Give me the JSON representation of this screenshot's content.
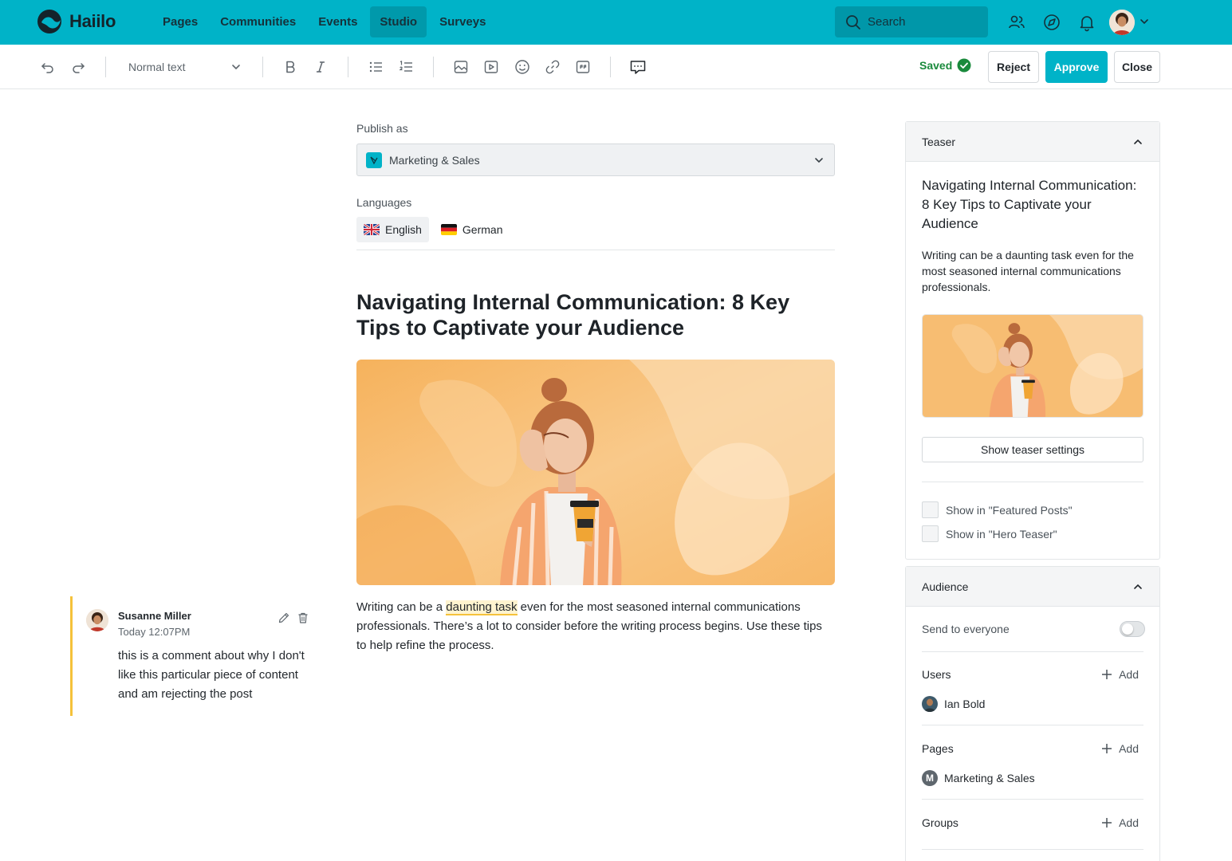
{
  "app": {
    "name": "Haiilo"
  },
  "nav": {
    "items": [
      {
        "label": "Pages"
      },
      {
        "label": "Communities"
      },
      {
        "label": "Events"
      },
      {
        "label": "Studio",
        "active": true
      },
      {
        "label": "Surveys"
      }
    ],
    "search_placeholder": "Search",
    "icons": [
      "colleagues-icon",
      "compass-icon",
      "bell-icon",
      "user-avatar",
      "chevron-down-icon"
    ]
  },
  "toolbar": {
    "text_style": "Normal text",
    "icons": [
      "undo-icon",
      "redo-icon",
      "bold-icon",
      "italic-icon",
      "bullet-list-icon",
      "numbered-list-icon",
      "image-icon",
      "video-icon",
      "emoji-icon",
      "link-icon",
      "quote-icon",
      "comment-icon"
    ],
    "saved_label": "Saved",
    "reject_label": "Reject",
    "approve_label": "Approve",
    "close_label": "Close"
  },
  "editor": {
    "publish_as_label": "Publish as",
    "publish_as_value": "Marketing & Sales",
    "languages_label": "Languages",
    "languages": [
      {
        "label": "English",
        "active": true
      },
      {
        "label": "German",
        "active": false
      }
    ],
    "title": "Navigating Internal Communication: 8 Key Tips to Captivate your Audience",
    "body_before": "Writing can be a ",
    "body_highlight": "daunting task",
    "body_after": " even for the most seasoned internal communications professionals. There’s a lot to consider before the writing process begins. Use these tips to help refine the process."
  },
  "comment": {
    "author": "Susanne Miller",
    "time": "Today 12:07PM",
    "text": "this is a comment about why I don't like this particular piece of content and am rejecting the post",
    "accent_color": "#f5c23b"
  },
  "teaser_panel": {
    "header": "Teaser",
    "title": "Navigating Internal Communication: 8 Key Tips to Captivate your Audience",
    "description": "Writing can be a daunting task even for the most seasoned internal communications professionals.",
    "settings_button": "Show teaser settings",
    "checkboxes": [
      {
        "label": "Show in \"Featured Posts\"",
        "checked": false
      },
      {
        "label": "Show in \"Hero Teaser\"",
        "checked": false
      }
    ]
  },
  "audience_panel": {
    "header": "Audience",
    "send_to_everyone_label": "Send to everyone",
    "send_to_everyone": false,
    "users_label": "Users",
    "users": [
      {
        "name": "Ian Bold"
      }
    ],
    "pages_label": "Pages",
    "pages": [
      {
        "name": "Marketing & Sales",
        "initial": "M"
      }
    ],
    "groups_label": "Groups",
    "add_label": "Add"
  },
  "colors": {
    "brand": "#00b3c8",
    "success": "#1a8a3c",
    "highlight": "#fff3cf"
  }
}
